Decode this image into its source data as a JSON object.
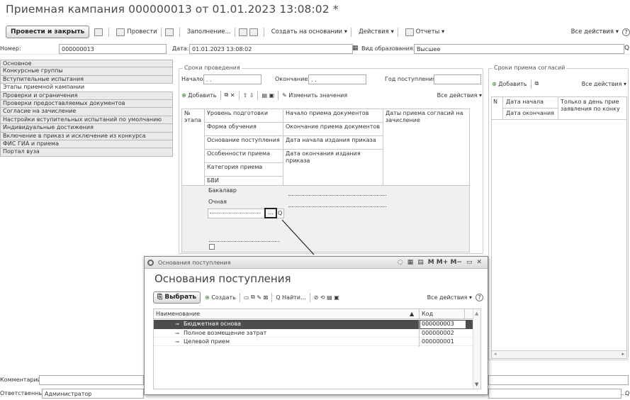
{
  "window": {
    "title": "Приемная кампания 000000013 от 01.01.2023 13:08:02 *"
  },
  "toolbar": {
    "post_close": "Провести и закрыть",
    "post": "Провести",
    "fill": "Заполнение...",
    "create_based": "Создать на основании",
    "actions": "Действия",
    "reports": "Отчеты",
    "all_actions": "Все действия",
    "help": "?"
  },
  "header": {
    "number_label": "Номер:",
    "number_value": "000000013",
    "date_label": "Дата:",
    "date_value": "01.01.2023 13:08:02",
    "edu_label": "Вид образования:",
    "edu_value": "Высшее"
  },
  "tabs": [
    {
      "label": "Основное"
    },
    {
      "label": "Конкурсные группы"
    },
    {
      "label": "Вступительные испытания"
    },
    {
      "label": "Этапы приемной кампании"
    },
    {
      "label": "Проверки и ограничения"
    },
    {
      "label": "Проверки предоставляемых документов"
    },
    {
      "label": "Согласие на зачисление"
    },
    {
      "label": "Настройки вступительных испытаний по умолчанию"
    },
    {
      "label": "Индивидуальные достижения"
    },
    {
      "label": "Включение в приказ и исключение из конкурса"
    },
    {
      "label": "ФИС ГИА и приема"
    },
    {
      "label": "Портал вуза"
    }
  ],
  "stages": {
    "period_legend": "Сроки проведения",
    "start_label": "Начало:",
    "start_value": " .  .",
    "end_label": "Окончание:",
    "end_value": " .  .",
    "year_label": "Год поступления:",
    "add": "Добавить",
    "change_values": "Изменить значения",
    "all_actions": "Все действия",
    "col_stage_a": "№",
    "col_stage_b": "этапа",
    "col_level": "Уровень подготовки",
    "col_form": "Форма обучения",
    "col_basis": "Основание поступления",
    "col_features": "Особенности приема",
    "col_category": "Категория приема",
    "col_bvi": "БВИ",
    "col_doc_start": "Начало приема документов",
    "col_doc_end": "Окончание приема документов",
    "col_order_start": "Дата начала издания приказа",
    "col_order_end": "Дата окончания издания приказа",
    "col_consent": "Даты приема согласий на зачисление",
    "row_level": "Бакалавр",
    "row_form": "Очная",
    "ellipsis": "..."
  },
  "consent": {
    "legend": "Сроки приема согласий",
    "add": "Добавить",
    "all_actions": "Все действия",
    "col_n": "N",
    "col_start": "Дата начала",
    "col_end": "Дата окончания",
    "col_only_day": "Только в день прие заявления по конку"
  },
  "footer": {
    "comment_label": "Комментарий:",
    "responsible_label": "Ответственный:",
    "responsible_value": "Администратор"
  },
  "dialog": {
    "window_title": "Основания поступления",
    "heading": "Основания поступления",
    "mem_buttons": "M  M+  M−",
    "select": "Выбрать",
    "create": "Создать",
    "find": "Найти...",
    "all_actions": "Все действия",
    "col_name": "Наименование",
    "col_code": "Код",
    "rows": [
      {
        "name": "Бюджетная основа",
        "code": "000000003"
      },
      {
        "name": "Полное возмещение затрат",
        "code": "000000002"
      },
      {
        "name": "Целевой прием",
        "code": "000000001"
      }
    ]
  }
}
